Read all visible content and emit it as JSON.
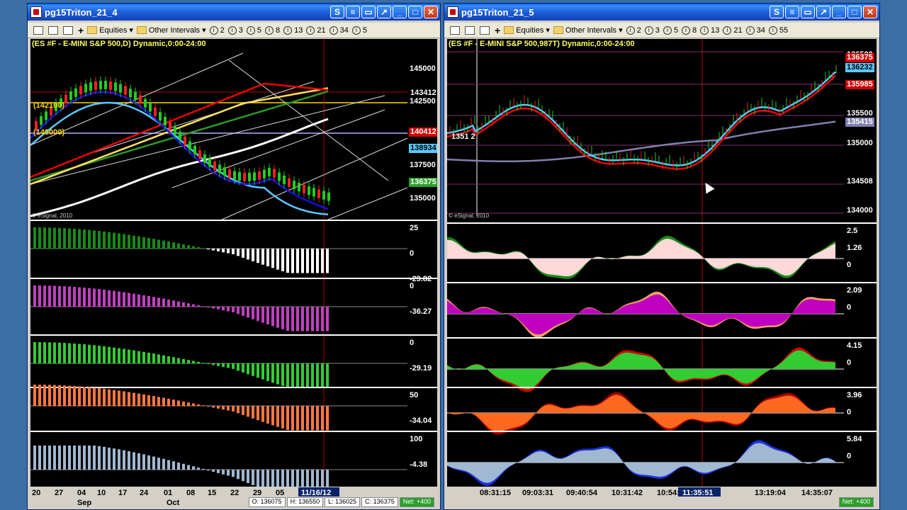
{
  "w1": {
    "title": "pg15Triton_21_4",
    "chart_title": "(ES #F - E-MINI S&P 500,D) Dynamic,0:00-24:00",
    "copyright": "© eSignal, 2010",
    "price_labels": [
      "145000",
      "142500",
      "140000",
      "137500",
      "135000"
    ],
    "flags": [
      {
        "t": "143412",
        "bg": "#000",
        "fg": "#fff"
      },
      {
        "t": "140412",
        "bg": "#d00000",
        "fg": "#fff"
      },
      {
        "t": "138934",
        "bg": "#5cc8ff",
        "fg": "#000"
      },
      {
        "t": "136375",
        "bg": "#2aa02a",
        "fg": "#fff"
      }
    ],
    "annotations": [
      "(142100)",
      "(140000)"
    ],
    "pane_labels": [
      [
        "25",
        "0",
        "-29.82"
      ],
      [
        "0",
        "-36.27"
      ],
      [
        "0",
        "-29.19"
      ],
      [
        "50",
        "-34.04"
      ],
      [
        "100",
        "-4.38"
      ]
    ],
    "x_labels": [
      "20",
      "27",
      "04",
      "10",
      "17",
      "24",
      "01",
      "08",
      "15",
      "22",
      "29",
      "05",
      "11/16/12"
    ],
    "months": [
      "Sep",
      "Oct"
    ],
    "ohlc": {
      "o": "O: 136075",
      "h": "H: 136550",
      "l": "L: 136025",
      "c": "C: 136375",
      "net": "Net: +400"
    }
  },
  "w2": {
    "title": "pg15Triton_21_5",
    "chart_title": "(ES #F - E-MINI S&P 500,987T) Dynamic,0:00-24:00",
    "copyright": "© eSignal, 2010",
    "price_labels": [
      "136500",
      "135500",
      "135000",
      "134000"
    ],
    "flags": [
      {
        "t": "136375",
        "bg": "#d00000",
        "fg": "#fff"
      },
      {
        "t": "136232",
        "bg": "#5cc8ff",
        "fg": "#000"
      },
      {
        "t": "135985",
        "bg": "#d00000",
        "fg": "#fff"
      },
      {
        "t": "135415",
        "bg": "#8080b0",
        "fg": "#fff"
      },
      {
        "t": "134508",
        "bg": "#000",
        "fg": "#fff"
      }
    ],
    "pane_labels": [
      [
        "2.5",
        "1.26",
        "0"
      ],
      [
        "2.09",
        "0"
      ],
      [
        "4.15",
        "0"
      ],
      [
        "3.96",
        "0"
      ],
      [
        "5.84",
        "0"
      ]
    ],
    "x_labels": [
      "08:31:15",
      "09:03:31",
      "09:40:54",
      "10:31:42",
      "10:54:",
      "11:35:51",
      "13:19:04",
      "14:35:07"
    ],
    "crosshair_time": "11:35:51",
    "net": "Net: +400",
    "price_marker": "1351 2"
  },
  "toolbar": {
    "equities": "Equities",
    "other": "Other Intervals",
    "intervals_w1": [
      "2",
      "3",
      "5",
      "8",
      "13",
      "21",
      "34",
      "5"
    ],
    "intervals_w2": [
      "2",
      "3",
      "5",
      "8",
      "13",
      "21",
      "34",
      "55"
    ]
  },
  "colors": {
    "titlebar": "#1e5fd8",
    "chart_bg": "#000000"
  }
}
